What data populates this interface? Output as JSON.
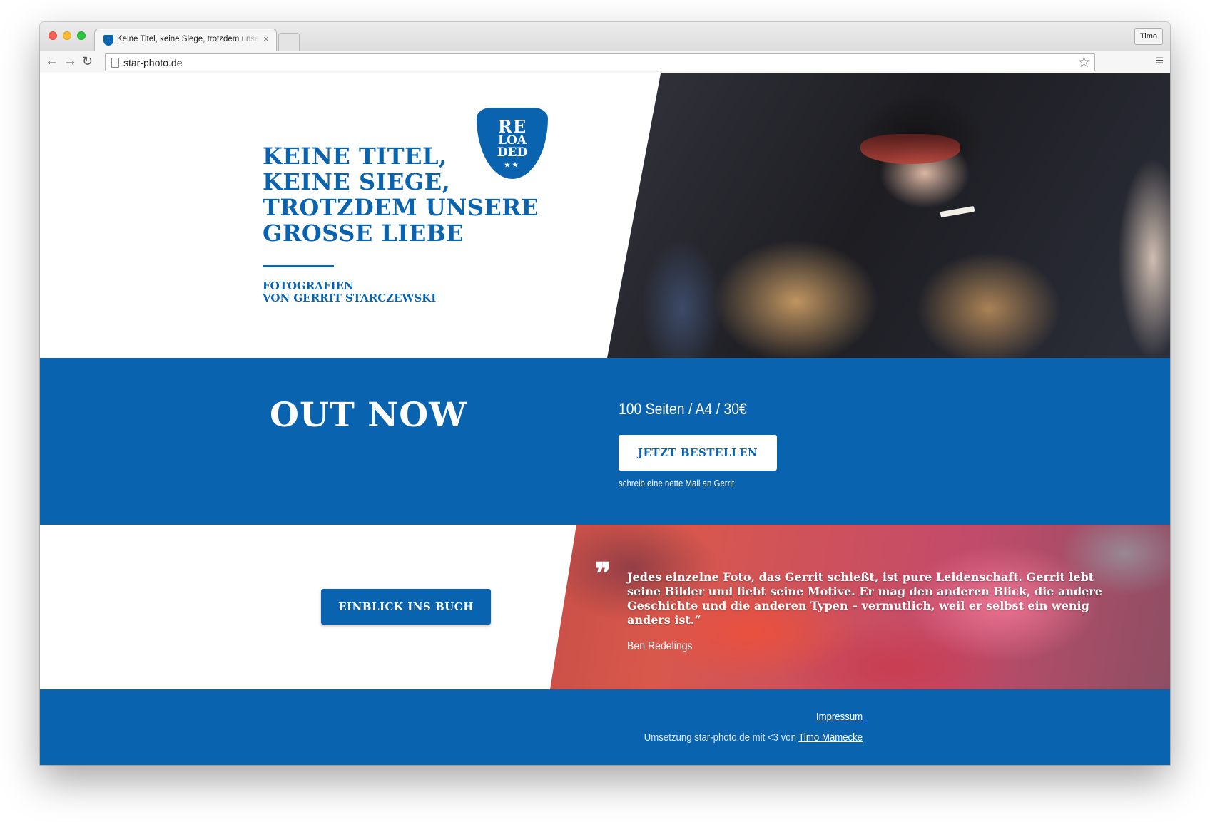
{
  "browser": {
    "tab_title": "Keine Titel, keine Siege, trotzdem unsere grosse Liebe",
    "tab_close_glyph": "×",
    "profile_name": "Timo",
    "url": "star-photo.de",
    "icons": {
      "back": "back-arrow-icon",
      "forward": "forward-arrow-icon",
      "reload": "reload-icon",
      "bookmark": "star-icon",
      "menu": "hamburger-menu-icon"
    }
  },
  "hero": {
    "badge": {
      "line1": "RE",
      "line2": "LOA",
      "line3": "DED",
      "stars": "★★"
    },
    "title_lines": [
      "Keine Titel,",
      "keine Siege,",
      "trotzdem unsere",
      "grosse Liebe"
    ],
    "subtitle_lines": [
      "Fotografien",
      "von Gerrit Starczewski"
    ]
  },
  "cta": {
    "headline": "Out now",
    "book_info": "100 Seiten / A4 / 30€",
    "order_button": "Jetzt bestellen",
    "mail_hint": "schreib eine nette Mail an Gerrit"
  },
  "quote": {
    "preview_button": "Einblick ins Buch",
    "quote_mark": "❞",
    "text": "Jedes einzelne Foto, das Gerrit schießt, ist pure Leidenschaft. Gerrit lebt seine Bilder und liebt seine Motive. Er mag den anderen Blick, die andere Geschichte und die anderen Typen – vermutlich, weil er selbst ein wenig anders ist.“",
    "author": "Ben Redelings"
  },
  "footer": {
    "impressum": "Impressum",
    "credit_prefix": "Umsetzung star-photo.de mit <3 von ",
    "credit_author": "Timo Mämecke"
  },
  "colors": {
    "brand_blue": "#0a63ae",
    "white": "#ffffff"
  }
}
